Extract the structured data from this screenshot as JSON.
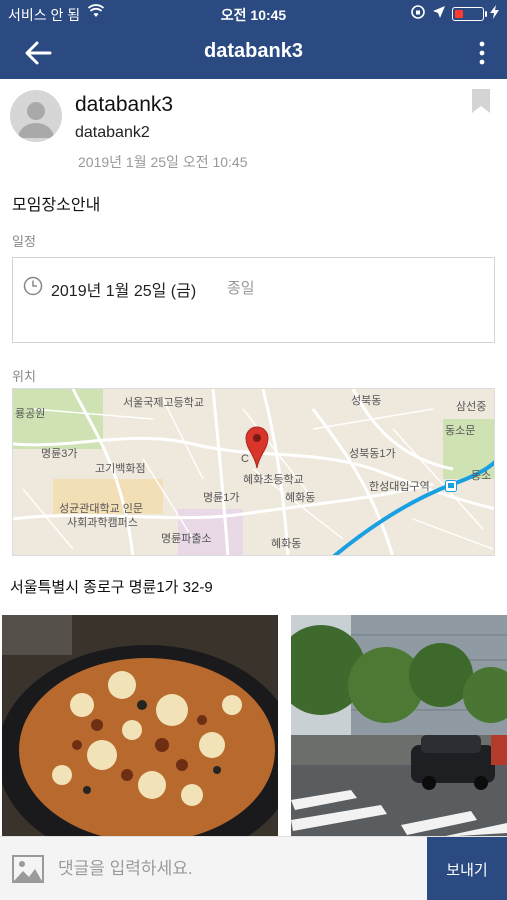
{
  "status_bar": {
    "carrier": "서비스 안 됨",
    "time": "오전 10:45"
  },
  "navbar": {
    "title": "databank3"
  },
  "post": {
    "author_name": "databank3",
    "author_sub": "databank2",
    "posted_at": "2019년 1월 25일 오전 10:45",
    "title": "모임장소안내",
    "schedule_label": "일정",
    "schedule_date": "2019년 1월 25일 (금)",
    "schedule_allday": "종일",
    "location_label": "위치",
    "address": "서울특별시 종로구 명륜1가 32-9"
  },
  "map": {
    "labels": {
      "school_intl": "서울국제고등학교",
      "seongbuk": "성북동",
      "samseon": "삼선중",
      "yonggong": "룡공원",
      "dongsomun": "동소문",
      "myeongryun3": "명륜3가",
      "gogi": "고기백화점",
      "seongbuk1": "성북동1가",
      "hyehwa_elem": "혜화초등학교",
      "myeongryun1": "명륜1가",
      "hyehwa": "혜화동",
      "station": "한성대입구역",
      "dongsun": "동소",
      "skku": "성균관대학교 인문",
      "skku2": "사회과학캠퍼스",
      "police": "명륜파출소",
      "hyehwa2": "혜화동",
      "c_label": "C"
    },
    "colors": {
      "road": "#ffffff",
      "subway": "#1aa0e0",
      "pin": "#d9352b"
    }
  },
  "comment": {
    "placeholder": "댓글을 입력하세요.",
    "send_label": "보내기"
  },
  "colors": {
    "primary": "#2b4a82"
  }
}
